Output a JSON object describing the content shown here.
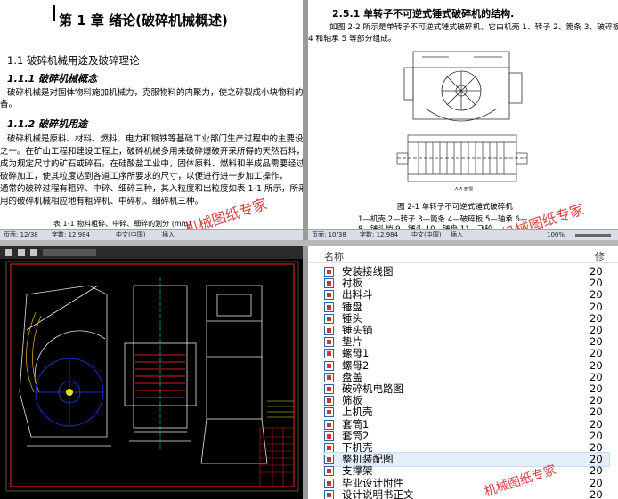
{
  "doc_left": {
    "chapter_title": "第 1 章     绪论(破碎机械概述)",
    "section_1_1": "1.1 破碎机械用途及破碎理论",
    "section_1_1_1": "1.1.1 破碎机械概念",
    "para_1": "破碎机械是对固体物料施加机械力，克服物料的内聚力，使之碎裂成小块物料的设",
    "para_1b": "备。",
    "section_1_1_2": "1.1.2 破碎机用途",
    "para_2": [
      "破碎机械是原料、材料、燃料、电力和钢铁等基础工业部门生产过程中的主要设备",
      "之一。在矿山工程和建设工程上，破碎机械多用来破碎爆破开采所得的天然石料，使之",
      "成为规定尺寸的矿石或碎石。在硅酸盐工业中，固体原料、燃料和半成品需要经过各种",
      "破碎加工，使其粒度达到各道工序所要求的尺寸，以便进行进一步加工操作。",
      "    通常的破碎过程有粗碎、中碎、细碎三种，其入粒度和出粒度如表 1-1 所示，所采",
      "用的破碎机械相应地有粗碎机、中碎机、细碎机三种。"
    ],
    "table_caption": "表 1-1    物料粗碎、中碎、细碎的划分 (mm)",
    "watermark": "机械图纸专家",
    "status": {
      "page": "页面: 12/38",
      "words": "字数: 12,984",
      "lang": "中文(中国)",
      "mode": "插入"
    }
  },
  "doc_right": {
    "section_title": "2.5.1 单转子不可逆式锤式破碎机的结构.",
    "para": [
      "如图 2-2 所示是单转子不可逆式锤式破碎机，它由机壳 1、转子 2、篦条 3、破碎板",
      "4 和轴承 5 等部分组成。"
    ],
    "section_label": "A-A 剖视",
    "figure_caption": "图 2-1 单转子不可逆式锤式破碎机",
    "legend": [
      "1—机壳  2—转子  3—篦条  4—破碎板  5—轴承  6—…",
      "8—锤头销  9—锤头  10—锤盘  11—飞轮"
    ],
    "watermark": "机械图纸专家",
    "status": {
      "page": "页面: 10/38",
      "words": "字数: 12,984",
      "lang": "中文(中国)",
      "mode": "插入",
      "zoom": "100%"
    }
  },
  "file_list": {
    "col_name": "名称",
    "col_date": "修",
    "items": [
      {
        "name": "安装接线图",
        "date": "20"
      },
      {
        "name": "衬板",
        "date": "20"
      },
      {
        "name": "出料斗",
        "date": "20"
      },
      {
        "name": "锤盘",
        "date": "20"
      },
      {
        "name": "锤头",
        "date": "20"
      },
      {
        "name": "锤头销",
        "date": "20"
      },
      {
        "name": "垫片",
        "date": "20"
      },
      {
        "name": "螺母1",
        "date": "20"
      },
      {
        "name": "螺母2",
        "date": "20"
      },
      {
        "name": "盘盖",
        "date": "20"
      },
      {
        "name": "破碎机电路图",
        "date": "20"
      },
      {
        "name": "筛板",
        "date": "20"
      },
      {
        "name": "上机壳",
        "date": "20"
      },
      {
        "name": "套筒1",
        "date": "20"
      },
      {
        "name": "套筒2",
        "date": "20"
      },
      {
        "name": "下机壳",
        "date": "20"
      },
      {
        "name": "整机装配图",
        "date": "20",
        "selected": true
      },
      {
        "name": "支撑架",
        "date": "20"
      },
      {
        "name": "毕业设计附件",
        "date": "20"
      },
      {
        "name": "设计说明书正文",
        "date": "20"
      }
    ],
    "watermark": "机械图纸专家"
  },
  "cad": {
    "colors": {
      "bg": "#000000",
      "frame": "#d02020",
      "part": "#e8e8e8",
      "detail": "#2040ff",
      "mark": "#e0e020",
      "accent": "#00c8c8"
    }
  }
}
